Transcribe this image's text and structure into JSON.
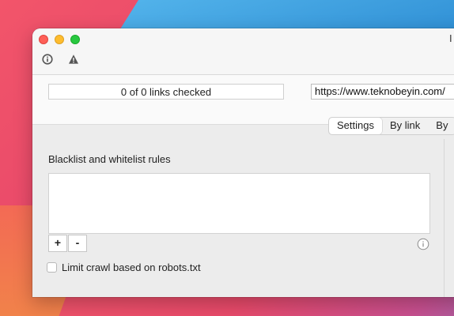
{
  "window": {
    "title_fragment": "I"
  },
  "toolbar": {
    "icons": [
      "info-icon",
      "warning-icon"
    ]
  },
  "status": {
    "links_checked": "0 of 0 links checked"
  },
  "url_field": {
    "value": "https://www.teknobeyin.com/"
  },
  "tabs": [
    {
      "label": "Settings",
      "selected": true
    },
    {
      "label": "By link",
      "selected": false
    },
    {
      "label": "By",
      "selected": false
    }
  ],
  "settings": {
    "rules_heading": "Blacklist and whitelist rules",
    "add_label": "+",
    "remove_label": "-",
    "robots_checkbox_label": "Limit crawl based on robots.txt",
    "robots_checked": false
  },
  "colors": {
    "close": "#fe5f57",
    "minimize": "#febc2e",
    "zoom": "#28c840"
  }
}
